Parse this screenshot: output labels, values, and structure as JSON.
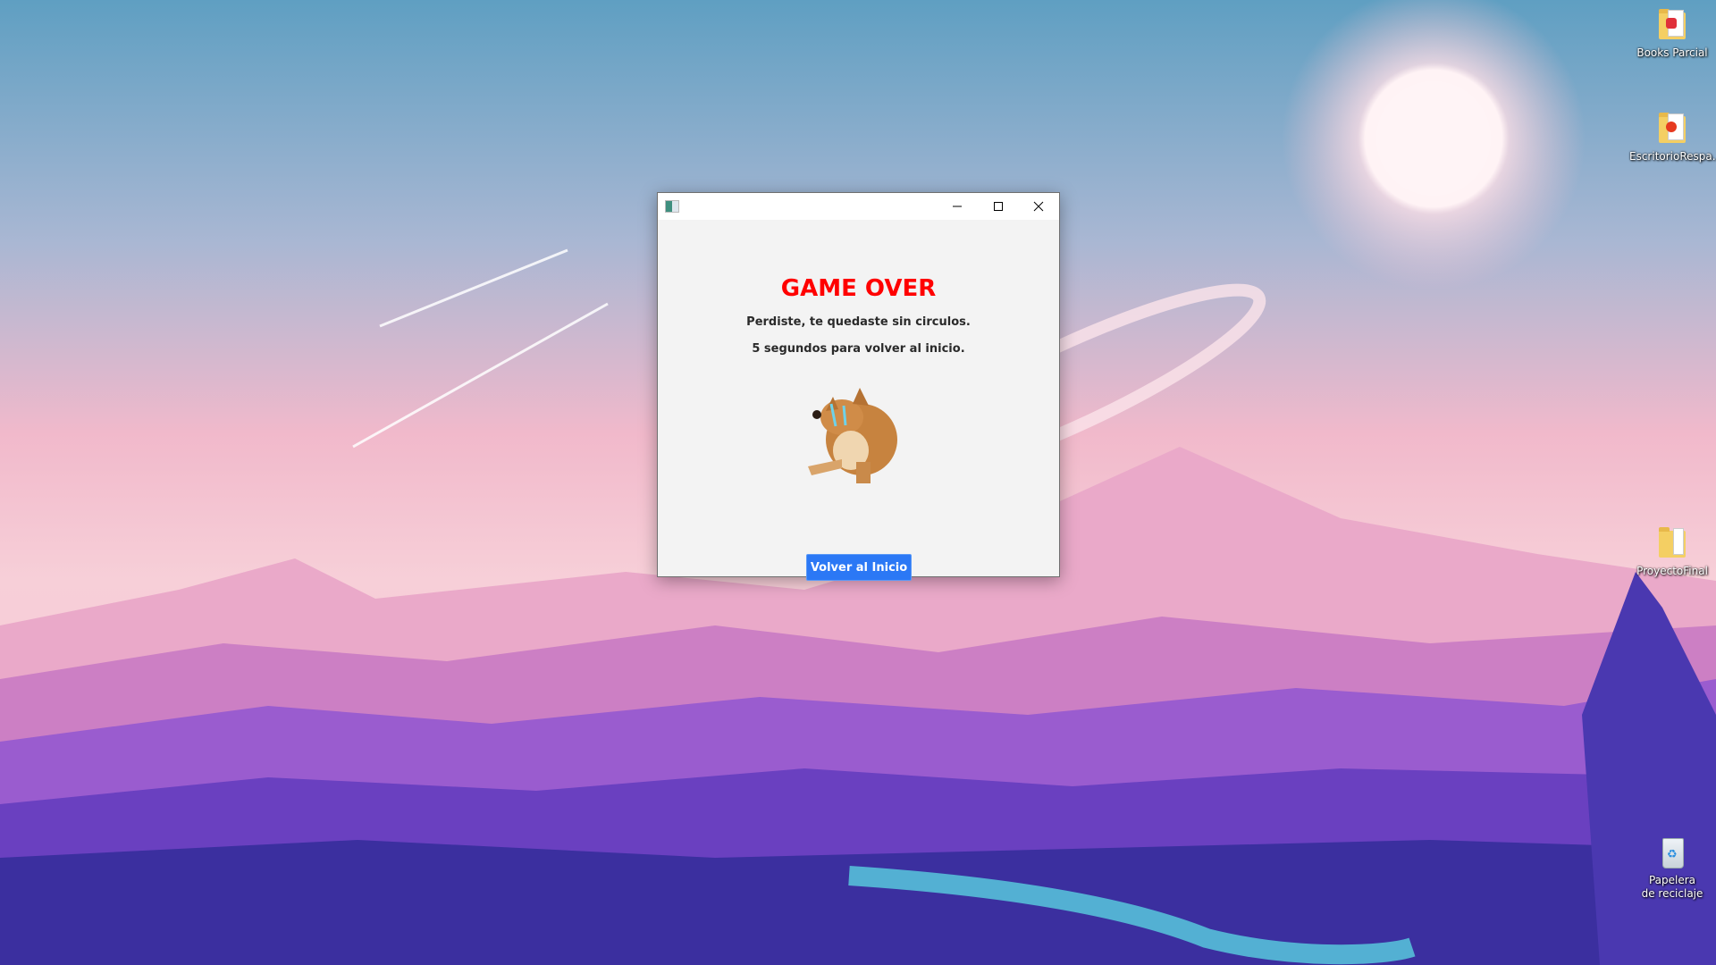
{
  "desktop": {
    "icons": [
      {
        "label": "Books Parcial",
        "icon": "folder-pdf-icon"
      },
      {
        "label": "EscritorioRespa...",
        "icon": "folder-acrobat-icon"
      },
      {
        "label": "ProyectoFinal",
        "icon": "folder-icon"
      },
      {
        "label": "Papelera de reciclaje",
        "icon": "recycle-bin-icon"
      }
    ]
  },
  "dialog": {
    "title_heading": "GAME OVER",
    "message": "Perdiste, te quedaste sin circulos.",
    "countdown": "5 segundos para volver al inicio.",
    "button_label": "Volver al Inicio",
    "image": "crying-shiba-dog",
    "colors": {
      "heading": "#ff0000",
      "button": "#2b78f5"
    }
  }
}
